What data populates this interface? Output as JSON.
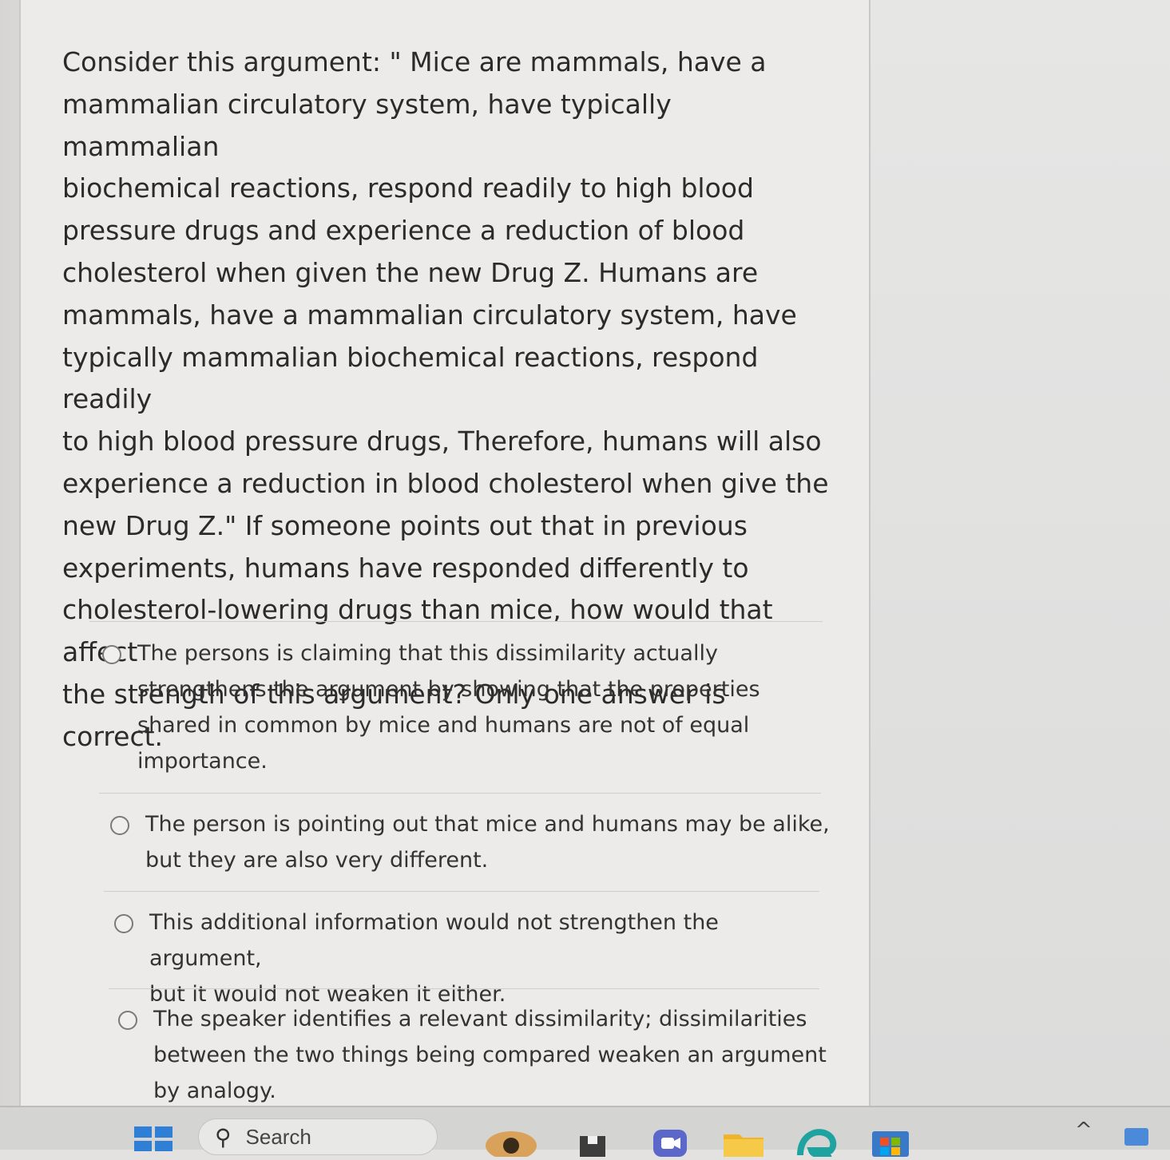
{
  "question": {
    "text": "Consider this argument: \" Mice are mammals, have a\nmammalian circulatory system, have typically mammalian\nbiochemical reactions, respond readily to high blood\npressure drugs and experience a reduction of blood\ncholesterol when given the new Drug Z.  Humans are\nmammals, have a mammalian circulatory system, have\ntypically mammalian biochemical reactions, respond readily\nto high blood pressure drugs, Therefore, humans will also\nexperience a reduction in blood cholesterol when give the\nnew Drug Z.\"  If someone points out that in previous\nexperiments, humans have responded differently to\ncholesterol-lowering drugs than mice, how would that affect\nthe strength of this argument?  Only one answer is correct."
  },
  "options": [
    {
      "text": "The persons is claiming that this dissimilarity actually\nstrengthens the argument by showing that the properties\nshared in common by mice and humans are not of equal\nimportance.",
      "selected": false
    },
    {
      "text": "The person is pointing out that mice and humans may be alike,\nbut they are also very different.",
      "selected": false
    },
    {
      "text": "This additional information would not strengthen the argument,\nbut it would not weaken it either.",
      "selected": false
    },
    {
      "text": "The speaker identifies a relevant dissimilarity; dissimilarities\nbetween the two things being compared weaken an argument\nby analogy.",
      "selected": false
    }
  ],
  "taskbar": {
    "search_label": "Search",
    "search_icon": "search-icon",
    "apps": [
      "windows-start-icon",
      "copilot-icon",
      "file-explorer-icon",
      "video-call-icon",
      "folder-icon",
      "edge-browser-icon",
      "store-icon"
    ],
    "accent_color": "#2f7fd6"
  }
}
